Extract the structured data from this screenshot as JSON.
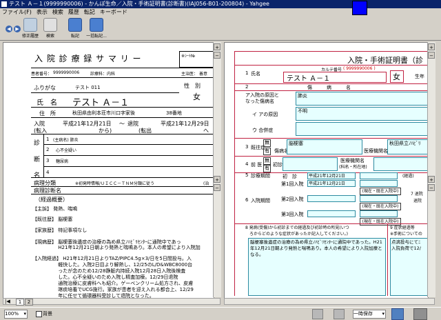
{
  "window": {
    "title": "テスト Ａ－１(9999990006) - かんぽ生命／入院・手術証明書(診断書)(IAJ056-B01-200804) - Yahgee"
  },
  "menu": [
    "ファイル(F)",
    "表示",
    "検索",
    "履歴",
    "転記",
    "キーボード"
  ],
  "toolbar": {
    "back": "◀",
    "forward": "▶",
    "items": [
      {
        "label": "修正履歴"
      },
      {
        "label": "検索"
      },
      {
        "label": "転記"
      },
      {
        "label": "一括転記..."
      }
    ]
  },
  "left_doc": {
    "title": "入 院 診 療 録 サ マ リ ー",
    "stamp": "※ｼｰﾄ№",
    "patient_no_label": "患者番号：",
    "patient_no": "9999990006",
    "dept_label": "診療科：",
    "dept": "内科",
    "doctor_label": "主治医：",
    "doctor": "善意",
    "furigana_label": "ふりがな",
    "furigana": "テスト 011",
    "sex_label": "性　別",
    "sex": "女",
    "name_label": "氏　名",
    "name": "テスト Ａ－１",
    "address_label": "住　所",
    "address": "秋田県由利本荘市川口字家後",
    "address_no": "38番地",
    "admit_label": "入院",
    "transfer_in": "(転入",
    "admit_date": "平成21年12月21日",
    "tilde": "～",
    "discharge_label": "退院",
    "discharge_date": "平成21年12月29日",
    "from": "から)",
    "transfer_out": "(転出",
    "to": "へ",
    "diag_col1": "診",
    "diag_col2": "断",
    "diag_col3": "名",
    "diagnoses": [
      {
        "no": "1",
        "text": "(主病名) 肺炎"
      },
      {
        "no": "2",
        "text": "心不全疑い"
      },
      {
        "no": "3",
        "text": "糖尿病"
      },
      {
        "no": "4",
        "text": ""
      }
    ],
    "pathology_no_label": "病理分類",
    "pathology_note": "※初発時情報/ＵＩＣＣ－ＴＮＭ分類に従う",
    "pathology_tail": "(治",
    "pathology_name_label": "病理診断名",
    "course_title": "（経過概要）",
    "course": [
      "【主訴】 発熱、喘鳴",
      "【既往歴】 脳梗塞",
      "【家族歴】 特記事項なし",
      "【現病歴】 脳梗塞後遺症の治療の為め県立ﾉﾊﾋﾞﾘｾﾝﾀｰに通院中であっ",
      "　　　　　 H21年12月21日朝より発熱と喘鳴あり。本人の希望により入院加",
      "【入院経過】 H21年12月21日よりTAZ/PIPC4.5g×3/日を5日間投与。入",
      "　　　　　 軽快した。入院2日目より解熱し、12/25のL/D&WBC8000台",
      "　　　　　 ったが念のため12/28静脈内持続入院12月28日入院後検査",
      "　　　　　 した。心不全疑いのため入院し精査加療。12/29日退院",
      "　　　　　 通院治療に皮膚科へも紹介。ゲーベンクリーム処方され、皮膚",
      "　　　　　 喀痰培養でUCG施行。家族が患者を迎え入れる都合上、12/29",
      "　　　　　 年に任せて循環器科受診して退院となった。"
    ]
  },
  "left_footer": {
    "page1": "1",
    "page2": "2"
  },
  "right_doc": {
    "title": "入院・手術証明書（診",
    "karte_label": "カルテ番号",
    "karte_no": "( 9999990006 )",
    "name_no": "1",
    "name_label": "氏名",
    "name": "テスト Ａ－１",
    "sex": "女",
    "birth_label": "生年",
    "sec2_no": "2",
    "sec2_header": "傷　　　病　　　名",
    "a_label": "ア入院の原因と",
    "a_label2": "なった傷病名",
    "a_value": "肺炎",
    "i_label": "イ アの原因",
    "i_value": "不明",
    "u_label": "ウ 合併症",
    "sec3_no": "3",
    "sec3_label": "既往症",
    "kiou_nai": "無",
    "kiou_ari": "有",
    "kiou_disease_label": "傷病名",
    "kiou_disease": "脳梗塞",
    "kiou_hosp_label": "医療機関名",
    "kiou_hosp": "秋田県立ﾉﾊﾋﾞﾘ",
    "sec4_no": "4",
    "sec4_label": "前 医",
    "zen_nai": "無",
    "zen_ari": "有",
    "zen_shoshin": "初診",
    "zen_hosp_label": "医療機関名",
    "zen_hosp_label2": "(科名・所在地)",
    "sec5_no": "5",
    "sec5_label": "診療期間",
    "shoshin": "初　診",
    "shoshin_date": "平成21年12月21日",
    "sec6_no": "6",
    "sec6_label": "入院期間",
    "nyuin": [
      {
        "label": "第1回入院",
        "from": "平成21年12月21日",
        "to": "",
        "btn": "(現在・既在入院中)"
      },
      {
        "label": "第2回入院",
        "from": "",
        "to": "",
        "btn": "(現在・既在入院中)"
      },
      {
        "label": "第3回入院",
        "from": "",
        "to": "",
        "btn": "(現在・既在入院中)"
      }
    ],
    "shoshin_to": "(経過)",
    "sec7": "7 退院",
    "sec7b": "退院",
    "sec8_header": "8 発病(受傷)から初診までの経過及び初診時の所見(いつ",
    "sec8_header2": "ろからどのような症状があったか記入してください。)",
    "sec8_text": "脳梗塞後遺症の治療の為め県立ﾉﾊﾋﾞﾘｾﾝﾀｰに通院中であった。H21年12月21日朝より発熱と喘鳴あり。本人の希望により入院加療となる。",
    "sec9_header": "9 症状経過等",
    "sec9_header2": "※手術についての",
    "sec9_text": "点滴投与にてﾆ\n入院負荷で12/"
  },
  "status": {
    "zoom": "100%",
    "bg_label": "背景",
    "save_label": "一時保存"
  }
}
